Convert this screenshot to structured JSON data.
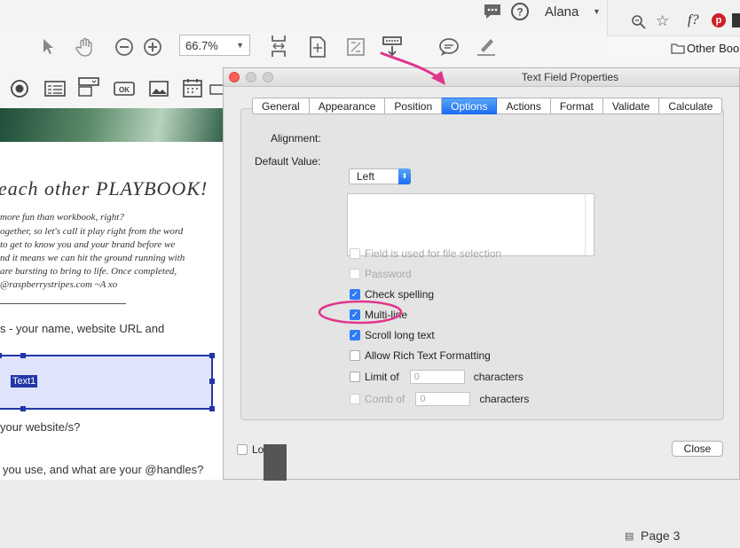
{
  "menubar": {
    "user": "Alana",
    "icons": [
      "chat-bubble-icon",
      "help-icon",
      "dropdown-icon"
    ]
  },
  "toolbar": {
    "zoom": "66.7%",
    "icons": [
      "pointer-icon",
      "hand-icon",
      "zoom-out-icon",
      "zoom-in-icon",
      "fit-width-icon",
      "fit-page-icon",
      "fullscreen-icon",
      "download-icon",
      "comment-icon",
      "highlight-icon"
    ]
  },
  "form_toolbar": {
    "icons": [
      "radio-button-icon",
      "list-box-icon",
      "dropdown-field-icon",
      "ok-button-icon",
      "image-icon",
      "date-field-icon",
      "signature-icon"
    ]
  },
  "browser": {
    "bookmark": "Other Boo",
    "icons": [
      "zoom-icon",
      "star-icon",
      "pinterest-icon"
    ]
  },
  "document": {
    "heading": "each other PLAYBOOK!",
    "lines": [
      "more fun than workbook, right?",
      "ogether, so let's call it play right from the word",
      "to get to know you and your brand before we",
      "nd it means we can hit the ground running with",
      "are bursting to bring to life. Once completed,",
      "@raspberrystripes.com   ~A xo"
    ],
    "q1": "s - your name, website URL and",
    "field_name": "Text1",
    "q2": "your website/s?",
    "q3": "you use, and what are your @handles?"
  },
  "dialog": {
    "title": "Text Field Properties",
    "tabs": [
      "General",
      "Appearance",
      "Position",
      "Options",
      "Actions",
      "Format",
      "Validate",
      "Calculate"
    ],
    "active_tab": "Options",
    "alignment_label": "Alignment:",
    "alignment_value": "Left",
    "default_value_label": "Default Value:",
    "options": [
      {
        "label": "Field is used for file selection",
        "checked": false,
        "disabled": true
      },
      {
        "label": "Password",
        "checked": false,
        "disabled": true
      },
      {
        "label": "Check spelling",
        "checked": true,
        "disabled": false
      },
      {
        "label": "Multi-line",
        "checked": true,
        "disabled": false
      },
      {
        "label": "Scroll long text",
        "checked": true,
        "disabled": false
      },
      {
        "label": "Allow Rich Text Formatting",
        "checked": false,
        "disabled": false
      }
    ],
    "limit": {
      "label": "Limit of",
      "value": "0",
      "suffix": "characters",
      "checked": false,
      "disabled": false
    },
    "comb": {
      "label": "Comb of",
      "value": "0",
      "suffix": "characters",
      "checked": false,
      "disabled": true
    },
    "locked_label": "Locked",
    "close_label": "Close"
  },
  "sidebar": {
    "page_label": "Page 3"
  },
  "colors": {
    "accent": "#1c6ef2",
    "annotation": "#e0368a",
    "field_border": "#2236a8"
  }
}
